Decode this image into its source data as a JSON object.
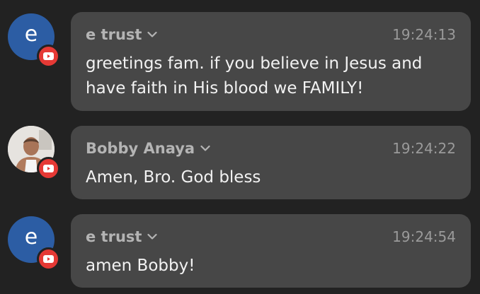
{
  "messages": [
    {
      "author": "e trust",
      "avatar_letter": "e",
      "avatar_color": "#2c5da4",
      "time": "19:24:13",
      "text": "greetings fam. if you believe in Jesus and have faith in His blood we FAMILY!",
      "badge_icon": "youtube-icon"
    },
    {
      "author": "Bobby Anaya",
      "avatar_letter": "",
      "time": "19:24:22",
      "text": "Amen, Bro. God bless",
      "badge_icon": "youtube-icon"
    },
    {
      "author": "e trust",
      "avatar_letter": "e",
      "avatar_color": "#2c5da4",
      "time": "19:24:54",
      "text": "amen Bobby!",
      "badge_icon": "youtube-icon"
    }
  ],
  "colors": {
    "background": "#222222",
    "bubble": "#474747",
    "badge": "#e53935"
  }
}
